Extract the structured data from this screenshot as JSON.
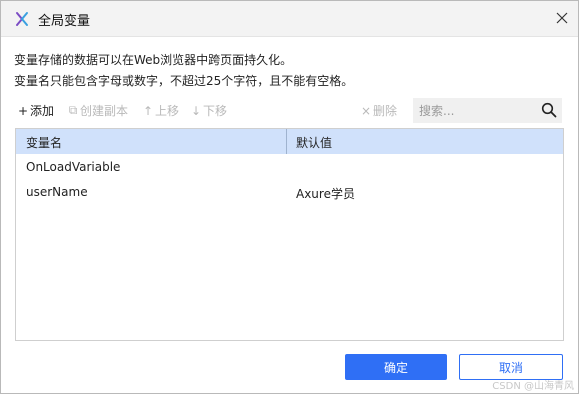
{
  "window": {
    "title": "全局变量",
    "icon": "axure-logo-icon",
    "close_icon": "close-icon"
  },
  "description": {
    "line1": "变量存储的数据可以在Web浏览器中跨页面持久化。",
    "line2": "变量名只能包含字母或数字，不超过25个字符，且不能有空格。"
  },
  "toolbar": {
    "add_label": "添加",
    "add_icon": "+",
    "copy_label": "创建副本",
    "copy_icon": "⧉",
    "up_label": "上移",
    "up_icon": "↑",
    "down_label": "下移",
    "down_icon": "↓",
    "delete_label": "删除",
    "delete_icon": "×"
  },
  "search": {
    "placeholder": "搜索...",
    "value": ""
  },
  "table": {
    "columns": [
      "变量名",
      "默认值"
    ],
    "rows": [
      {
        "name": "OnLoadVariable",
        "default": ""
      },
      {
        "name": "userName",
        "default": "Axure学员"
      }
    ]
  },
  "footer": {
    "ok_label": "确定",
    "cancel_label": "取消"
  },
  "watermark": "CSDN @山海青风",
  "colors": {
    "accent": "#2f6ff5",
    "header_bg": "#d0e1fb",
    "disabled_text": "#b9b9b9"
  }
}
